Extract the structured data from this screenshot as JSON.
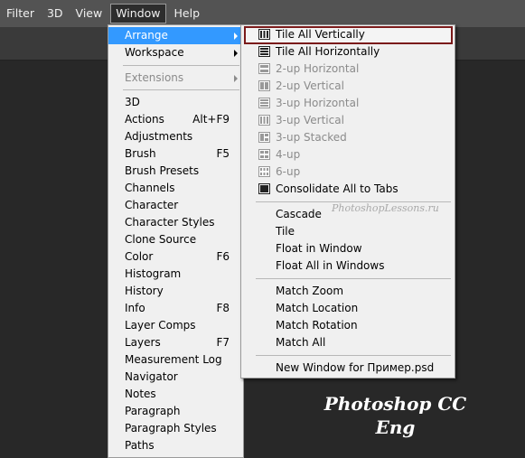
{
  "menubar": {
    "items": [
      {
        "label": "Filter"
      },
      {
        "label": "3D"
      },
      {
        "label": "View"
      },
      {
        "label": "Window"
      },
      {
        "label": "Help"
      }
    ]
  },
  "window_menu": {
    "items": [
      {
        "label": "Arrange",
        "shortcut": "",
        "state": "highlighted",
        "submenu": true
      },
      {
        "label": "Workspace",
        "shortcut": "",
        "state": "normal",
        "submenu": true
      },
      {
        "label": "Extensions",
        "shortcut": "",
        "state": "disabled",
        "submenu": true
      },
      {
        "label": "3D",
        "shortcut": ""
      },
      {
        "label": "Actions",
        "shortcut": "Alt+F9"
      },
      {
        "label": "Adjustments",
        "shortcut": ""
      },
      {
        "label": "Brush",
        "shortcut": "F5"
      },
      {
        "label": "Brush Presets",
        "shortcut": ""
      },
      {
        "label": "Channels",
        "shortcut": ""
      },
      {
        "label": "Character",
        "shortcut": ""
      },
      {
        "label": "Character Styles",
        "shortcut": ""
      },
      {
        "label": "Clone Source",
        "shortcut": ""
      },
      {
        "label": "Color",
        "shortcut": "F6"
      },
      {
        "label": "Histogram",
        "shortcut": ""
      },
      {
        "label": "History",
        "shortcut": ""
      },
      {
        "label": "Info",
        "shortcut": "F8"
      },
      {
        "label": "Layer Comps",
        "shortcut": ""
      },
      {
        "label": "Layers",
        "shortcut": "F7"
      },
      {
        "label": "Measurement Log",
        "shortcut": ""
      },
      {
        "label": "Navigator",
        "shortcut": ""
      },
      {
        "label": "Notes",
        "shortcut": ""
      },
      {
        "label": "Paragraph",
        "shortcut": ""
      },
      {
        "label": "Paragraph Styles",
        "shortcut": ""
      },
      {
        "label": "Paths",
        "shortcut": ""
      }
    ]
  },
  "arrange_submenu": {
    "items": [
      {
        "label": "Tile All Vertically",
        "icon": "tile-vertical-icon",
        "state": "selected"
      },
      {
        "label": "Tile All Horizontally",
        "icon": "tile-horizontal-icon",
        "state": "normal"
      },
      {
        "label": "2-up Horizontal",
        "icon": "two-up-horizontal-icon",
        "state": "disabled"
      },
      {
        "label": "2-up Vertical",
        "icon": "two-up-vertical-icon",
        "state": "disabled"
      },
      {
        "label": "3-up Horizontal",
        "icon": "three-up-horizontal-icon",
        "state": "disabled"
      },
      {
        "label": "3-up Vertical",
        "icon": "three-up-vertical-icon",
        "state": "disabled"
      },
      {
        "label": "3-up Stacked",
        "icon": "three-up-stacked-icon",
        "state": "disabled"
      },
      {
        "label": "4-up",
        "icon": "four-up-icon",
        "state": "disabled"
      },
      {
        "label": "6-up",
        "icon": "six-up-icon",
        "state": "disabled"
      },
      {
        "label": "Consolidate All to Tabs",
        "icon": "consolidate-tabs-icon",
        "state": "normal"
      },
      {
        "label": "Cascade"
      },
      {
        "label": "Tile"
      },
      {
        "label": "Float in Window"
      },
      {
        "label": "Float All in Windows"
      },
      {
        "label": "Match Zoom"
      },
      {
        "label": "Match Location"
      },
      {
        "label": "Match Rotation"
      },
      {
        "label": "Match All"
      },
      {
        "label": "New Window for Пример.psd"
      }
    ]
  },
  "watermark": "PhotoshopLessons.ru",
  "brand": {
    "line1": "Photoshop  CC",
    "line2": "Eng"
  },
  "colors": {
    "highlight": "#3399ff",
    "menu_bg": "#f0f0f0",
    "selected_border": "#7a1a1a",
    "canvas": "#282828"
  }
}
